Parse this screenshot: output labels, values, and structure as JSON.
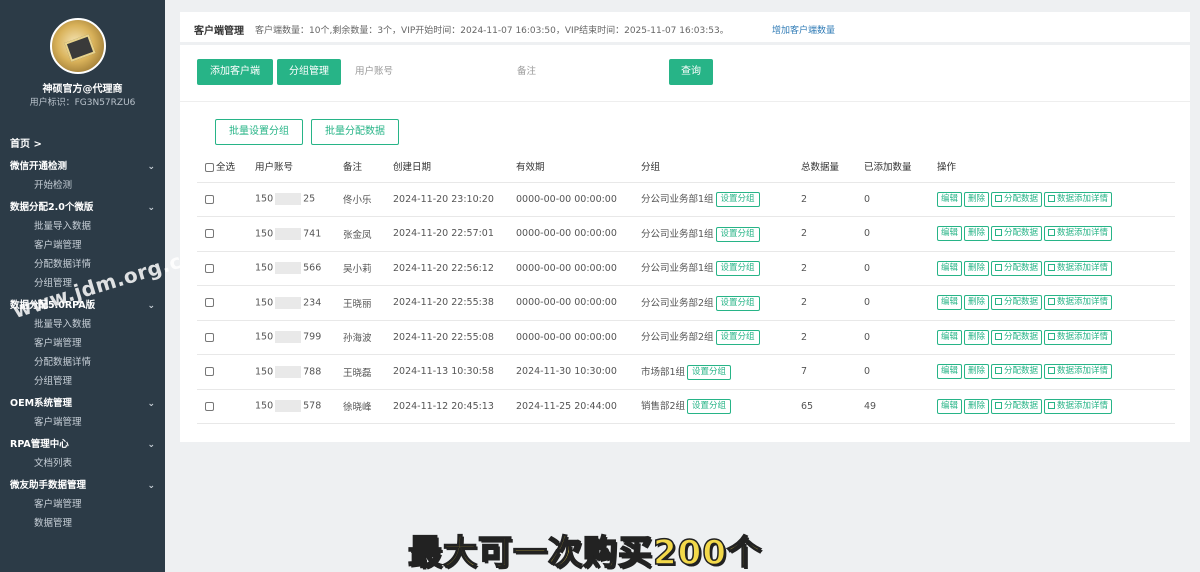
{
  "sidebar": {
    "user_name": "神硕官方@代理商",
    "user_id": "用户标识：FG3N57RZU6",
    "home": "首页 >",
    "groups": [
      {
        "title": "微信开通检测",
        "items": [
          "开始检测"
        ]
      },
      {
        "title": "数据分配2.0个微版",
        "items": [
          "批量导入数据",
          "客户端管理",
          "分配数据详情",
          "分组管理"
        ]
      },
      {
        "title": "数据分配5.0RPA版",
        "items": [
          "批量导入数据",
          "客户端管理",
          "分配数据详情",
          "分组管理"
        ]
      },
      {
        "title": "OEM系统管理",
        "items": [
          "客户端管理"
        ]
      },
      {
        "title": "RPA管理中心",
        "items": [
          "文档列表"
        ]
      },
      {
        "title": "微友助手数据管理",
        "items": [
          "客户端管理",
          "数据管理"
        ]
      }
    ]
  },
  "topbar": {
    "title": "客户端管理",
    "info": "客户端数量：10个,剩余数量：3个，VIP开始时间：2024-11-07 16:03:50，VIP结束时间：2025-11-07 16:03:53。",
    "link": "增加客户端数量"
  },
  "toolbar": {
    "add_client": "添加客户端",
    "group_manage": "分组管理",
    "account_placeholder": "用户账号",
    "note_placeholder": "备注",
    "query": "查询",
    "batch_group": "批量设置分组",
    "batch_assign": "批量分配数据"
  },
  "table": {
    "headers": [
      "全选",
      "用户账号",
      "备注",
      "创建日期",
      "有效期",
      "分组",
      "总数据量",
      "已添加数量",
      "操作"
    ],
    "set_group_label": "设置分组",
    "ops": [
      "编辑",
      "删除",
      "分配数据",
      "数据添加详情"
    ],
    "rows": [
      {
        "acc_a": "150",
        "acc_b": "25",
        "note": "佟小乐",
        "created": "2024-11-20 23:10:20",
        "expire": "0000-00-00 00:00:00",
        "group": "分公司业务部1组",
        "total": "2",
        "added": "0"
      },
      {
        "acc_a": "150",
        "acc_b": "741",
        "note": "张金凤",
        "created": "2024-11-20 22:57:01",
        "expire": "0000-00-00 00:00:00",
        "group": "分公司业务部1组",
        "total": "2",
        "added": "0"
      },
      {
        "acc_a": "150",
        "acc_b": "566",
        "note": "吴小莉",
        "created": "2024-11-20 22:56:12",
        "expire": "0000-00-00 00:00:00",
        "group": "分公司业务部1组",
        "total": "2",
        "added": "0"
      },
      {
        "acc_a": "150",
        "acc_b": "234",
        "note": "王晓丽",
        "created": "2024-11-20 22:55:38",
        "expire": "0000-00-00 00:00:00",
        "group": "分公司业务部2组",
        "total": "2",
        "added": "0"
      },
      {
        "acc_a": "150",
        "acc_b": "799",
        "note": "孙海波",
        "created": "2024-11-20 22:55:08",
        "expire": "0000-00-00 00:00:00",
        "group": "分公司业务部2组",
        "total": "2",
        "added": "0"
      },
      {
        "acc_a": "150",
        "acc_b": "788",
        "note": "王晓磊",
        "created": "2024-11-13 10:30:58",
        "expire": "2024-11-30 10:30:00",
        "group": "市场部1组",
        "total": "7",
        "added": "0"
      },
      {
        "acc_a": "150",
        "acc_b": "578",
        "note": "徐晓峰",
        "created": "2024-11-12 20:45:13",
        "expire": "2024-11-25 20:44:00",
        "group": "销售部2组",
        "total": "65",
        "added": "49"
      }
    ]
  },
  "overlay": {
    "watermark": "www.jdm.org.cn",
    "subtitle": "最大可一次购买200个"
  }
}
